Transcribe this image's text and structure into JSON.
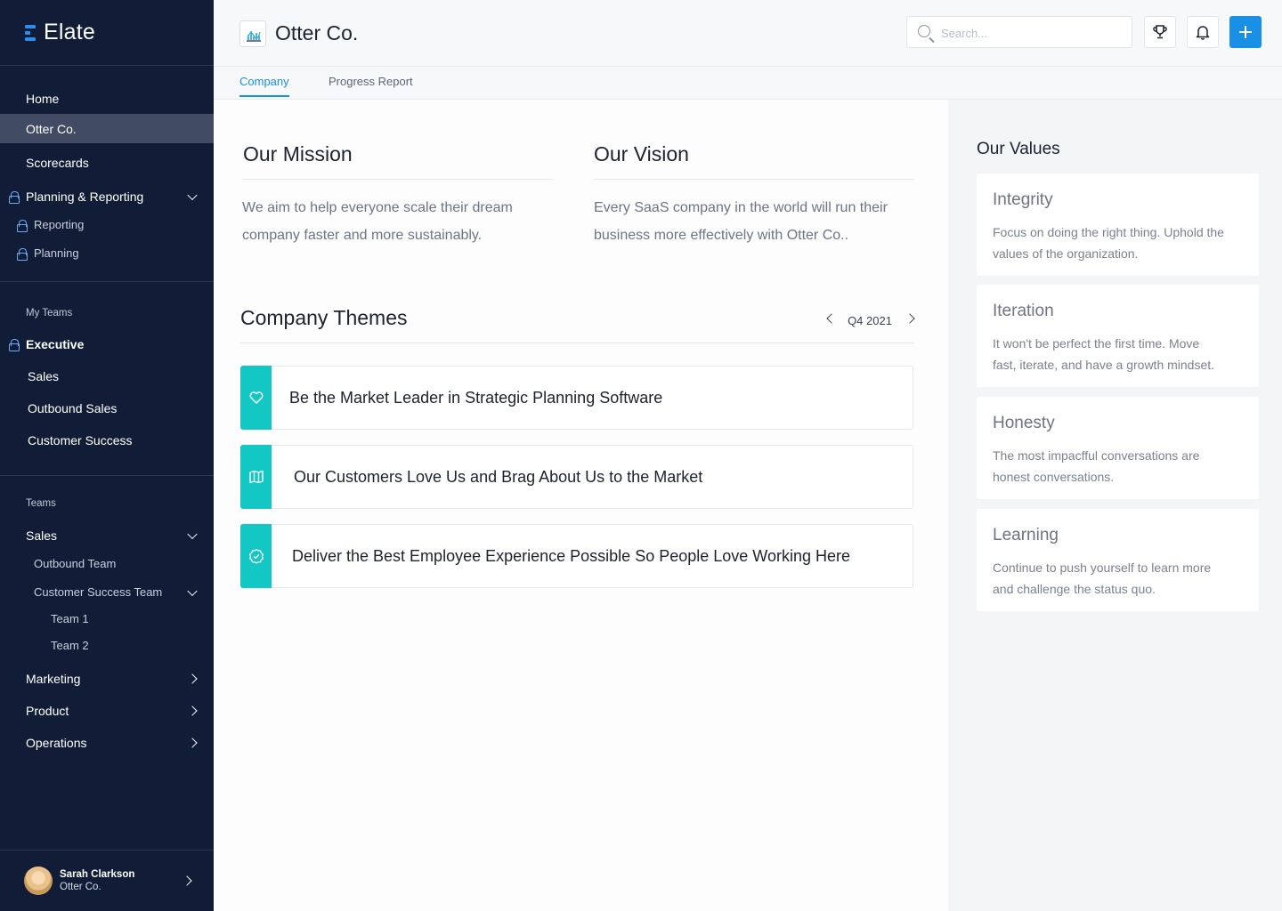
{
  "app": {
    "name": "Elate"
  },
  "sidebar": {
    "items": [
      {
        "label": "Home"
      },
      {
        "label": "Otter Co."
      },
      {
        "label": "Scorecards"
      },
      {
        "label": "Planning & Reporting"
      },
      {
        "label": "Reporting"
      },
      {
        "label": "Planning"
      }
    ],
    "my_teams_label": "My Teams",
    "my_teams": [
      {
        "label": "Executive"
      },
      {
        "label": "Sales"
      },
      {
        "label": "Outbound Sales"
      },
      {
        "label": "Customer Success"
      }
    ],
    "teams_label": "Teams",
    "teams": [
      {
        "label": "Sales"
      },
      {
        "label": "Outbound Team"
      },
      {
        "label": "Customer Success Team"
      },
      {
        "label": "Team 1"
      },
      {
        "label": "Team 2"
      },
      {
        "label": "Marketing"
      },
      {
        "label": "Product"
      },
      {
        "label": "Operations"
      }
    ],
    "profile": {
      "name": "Sarah Clarkson",
      "org": "Otter Co."
    }
  },
  "header": {
    "title": "Otter Co.",
    "search_placeholder": "Search...",
    "accent": "#1a8fe6"
  },
  "tabs": [
    {
      "label": "Company"
    },
    {
      "label": "Progress Report"
    }
  ],
  "mission": {
    "title": "Our Mission",
    "line1": "We aim to help everyone scale their dream",
    "line2": "company faster and more sustainably."
  },
  "vision": {
    "title": "Our Vision",
    "line1": "Every SaaS company in the world will run their",
    "line2": "business more effectively with Otter Co.."
  },
  "themes": {
    "title": "Company Themes",
    "period": "Q4 2021",
    "accent": "#12c7c4",
    "items": [
      {
        "icon": "heart-icon",
        "text": "Be the Market Leader in Strategic Planning Software"
      },
      {
        "icon": "map-icon",
        "text": "Our Customers Love Us and Brag About Us to the Market"
      },
      {
        "icon": "badge-check-icon",
        "text": "Deliver the Best Employee Experience Possible So People Love Working Here"
      }
    ]
  },
  "values": {
    "title": "Our Values",
    "items": [
      {
        "name": "Integrity",
        "line1": "Focus on doing the right thing. Uphold the",
        "line2": "values of the organization."
      },
      {
        "name": "Iteration",
        "line1": "It won't be perfect the first time. Move",
        "line2": "fast, iterate, and have a growth mindset."
      },
      {
        "name": "Honesty",
        "line1": "The most impacfful conversations are",
        "line2": "honest conversations."
      },
      {
        "name": "Learning",
        "line1": "Continue to push yourself to learn more",
        "line2": "and challenge the status quo."
      }
    ]
  }
}
